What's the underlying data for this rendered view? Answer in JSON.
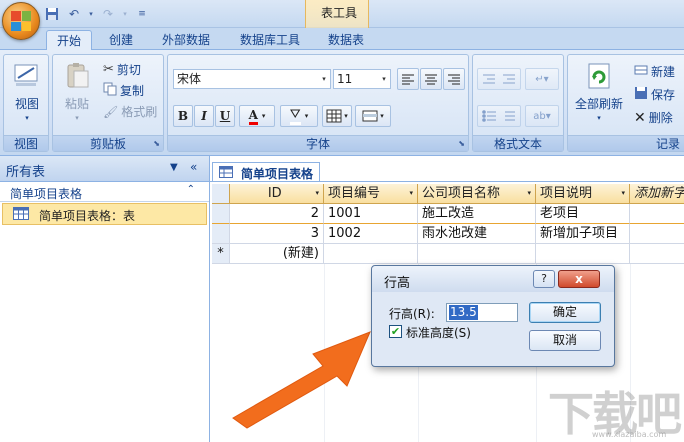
{
  "titlebar": {
    "context_title": "表工具"
  },
  "tabs": [
    {
      "label": "开始",
      "active": true
    },
    {
      "label": "创建"
    },
    {
      "label": "外部数据"
    },
    {
      "label": "数据库工具"
    },
    {
      "label": "数据表"
    }
  ],
  "ribbon": {
    "view": {
      "button": "视图",
      "group": "视图"
    },
    "clipboard": {
      "paste": "粘贴",
      "cut": "剪切",
      "copy": "复制",
      "format_painter": "格式刷",
      "group": "剪贴板"
    },
    "font": {
      "font_name": "宋体",
      "font_size": "11",
      "bold": "B",
      "italic": "I",
      "underline": "U",
      "font_color_glyph": "A",
      "group": "字体"
    },
    "rich_text": {
      "group": "格式文本"
    },
    "records": {
      "refresh_all": "全部刷新",
      "new": "新建",
      "save": "保存",
      "delete": "删除",
      "group": "记录"
    }
  },
  "nav": {
    "title": "所有表",
    "group_name": "简单项目表格",
    "item": "简单项目表格：表"
  },
  "document": {
    "tab_title": "简单项目表格",
    "columns": [
      "ID",
      "项目编号",
      "公司项目名称",
      "项目说明",
      "添加新字段"
    ],
    "rows": [
      {
        "id": "2",
        "code": "1001",
        "name": "施工改造",
        "desc": "老项目"
      },
      {
        "id": "3",
        "code": "1002",
        "name": "雨水池改建",
        "desc": "新增加子项目"
      }
    ],
    "new_row_marker": "*",
    "new_row_label": "(新建)"
  },
  "dialog": {
    "title": "行高",
    "help": "?",
    "close": "x",
    "row_height_label": "行高(R):",
    "row_height_value": "13.5",
    "standard_height_label": "标准高度(S)",
    "standard_height_checked": true,
    "ok": "确定",
    "cancel": "取消"
  },
  "watermark": {
    "main": "下载吧",
    "sub": "www.xiazaiba.com"
  },
  "colors": {
    "accent_arrow": "#f26d1d",
    "selection": "#316ac5",
    "header_gold": "#f9dfa0"
  }
}
